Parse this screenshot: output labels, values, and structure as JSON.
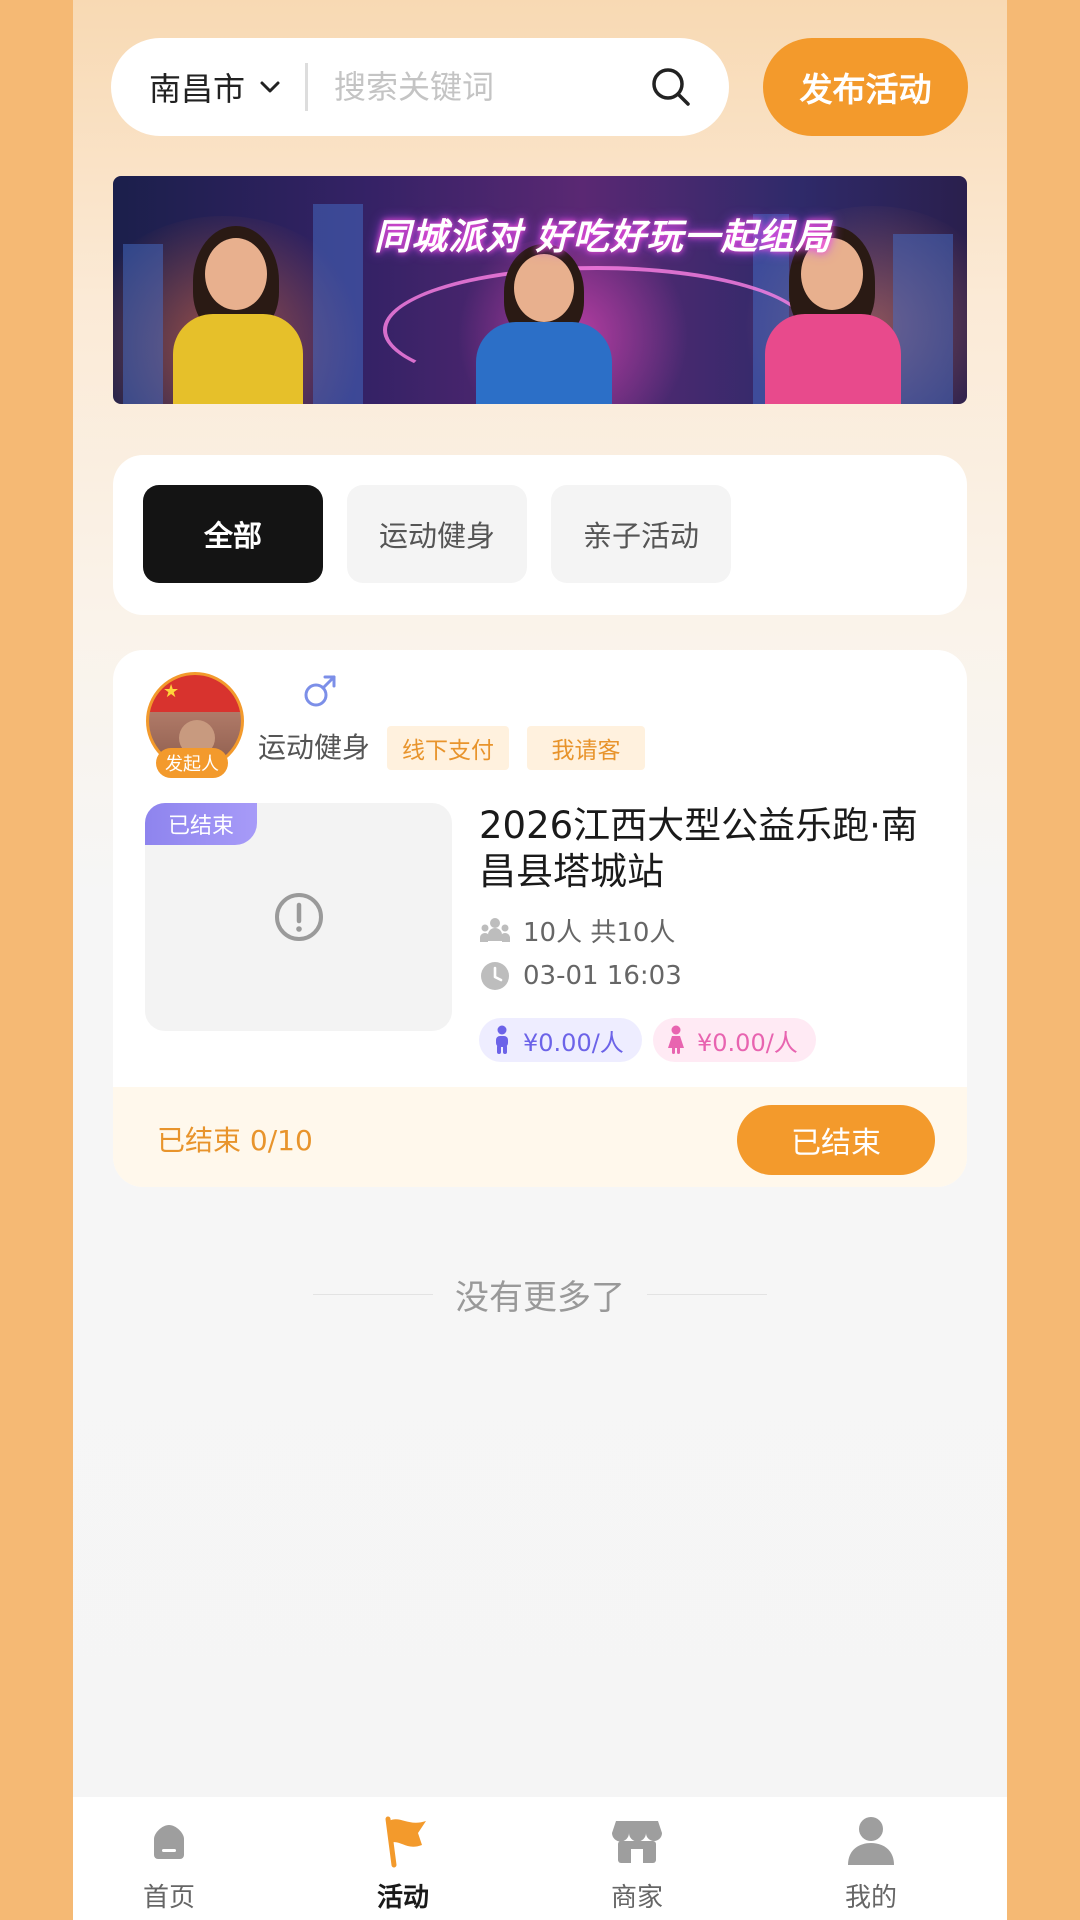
{
  "header": {
    "city": "南昌市",
    "search_placeholder": "搜索关键词",
    "publish_label": "发布活动"
  },
  "banner": {
    "headline": "同城派对 好吃好玩一起组局"
  },
  "categories": [
    {
      "label": "全部",
      "active": true
    },
    {
      "label": "运动健身",
      "active": false
    },
    {
      "label": "亲子活动",
      "active": false
    }
  ],
  "activity": {
    "initiator_badge": "发起人",
    "gender_icon": "male-icon",
    "category": "运动健身",
    "tags": [
      "线下支付",
      "我请客"
    ],
    "thumb_status": "已结束",
    "title": "2026江西大型公益乐跑·南昌县塔城站",
    "participants": "10人 共10人",
    "datetime": "03-01 16:03",
    "price_male": "¥0.00/人",
    "price_female": "¥0.00/人",
    "footer_status": "已结束 0/10",
    "action_label": "已结束",
    "colors": {
      "accent": "#F39A2C",
      "male": "#6C63E8",
      "female": "#E864B0"
    }
  },
  "list_end_text": "没有更多了",
  "nav": [
    {
      "label": "首页",
      "icon": "home-icon",
      "active": false
    },
    {
      "label": "活动",
      "icon": "flag-icon",
      "active": true
    },
    {
      "label": "商家",
      "icon": "shop-icon",
      "active": false
    },
    {
      "label": "我的",
      "icon": "user-icon",
      "active": false
    }
  ]
}
